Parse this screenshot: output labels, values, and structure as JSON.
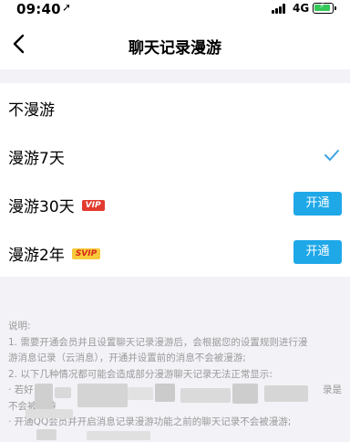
{
  "status_bar": {
    "time": "09:40",
    "network": "4G"
  },
  "nav": {
    "title": "聊天记录漫游"
  },
  "options": [
    {
      "label": "不漫游"
    },
    {
      "label": "漫游7天"
    },
    {
      "label": "漫游30天",
      "badge": "VIP",
      "button": "开通"
    },
    {
      "label": "漫游2年",
      "badge": "SVIP",
      "button": "开通"
    }
  ],
  "selected_option": "漫游7天",
  "notes": [
    "说明:",
    "1. 需要开通会员并且设置聊天记录漫游后，会根据您的设置规则进行漫",
    "游消息记录（云消息），开通并设置前的消息不会被漫游;",
    "2. 以下几种情况都可能会造成部分漫游聊天记录无法正常显示:",
    "· 若好",
    "录是",
    "不会被漫游",
    "· 开通QQ会员并开启消息记录漫游功能之前的聊天记录不会被漫游;"
  ],
  "colors": {
    "accent": "#1fa8e8",
    "check": "#3aa3e3",
    "vip": "#e23b2e",
    "svip": "#f8c93a"
  },
  "icons": [
    "back-chevron-icon",
    "location-arrow-icon",
    "signal-icon",
    "battery-icon",
    "checkmark-icon"
  ]
}
